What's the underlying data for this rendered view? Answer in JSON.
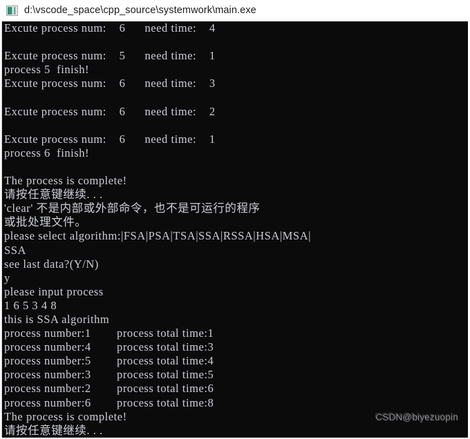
{
  "window": {
    "title": "d:\\vscode_space\\cpp_source\\systemwork\\main.exe",
    "icon": "console-window-icon",
    "titlebar_bg": "#ffffff",
    "console_bg": "#0b0b0b",
    "console_fg": "#c8c8d0"
  },
  "console": {
    "lines": [
      "Excute process num:    6      need time:    4",
      "",
      "Excute process num:    5      need time:    1",
      "process 5  finish!",
      "Excute process num:    6      need time:    3",
      "",
      "Excute process num:    6      need time:    2",
      "",
      "Excute process num:    6      need time:    1",
      "process 6  finish!",
      "",
      "The process is complete!",
      "请按任意键继续. . .",
      "'clear' 不是内部或外部命令，也不是可运行的程序",
      "或批处理文件。",
      "please select algorithm:|FSA|PSA|TSA|SSA|RSSA|HSA|MSA|",
      "SSA",
      "see last data?(Y/N)",
      "y",
      "please input process",
      "1 6 5 3 4 8",
      "this is SSA algorithm",
      "process number:1        process total time:1",
      "process number:4        process total time:3",
      "process number:5        process total time:4",
      "process number:3        process total time:5",
      "process number:2        process total time:6",
      "process number:6        process total time:8",
      "The process is complete!",
      "请按任意键继续. . ."
    ],
    "execution_log": [
      {
        "process_num": "6",
        "need_time": "4"
      },
      {
        "process_num": "5",
        "need_time": "1",
        "finish": "process 5  finish!"
      },
      {
        "process_num": "6",
        "need_time": "3"
      },
      {
        "process_num": "6",
        "need_time": "2"
      },
      {
        "process_num": "6",
        "need_time": "1",
        "finish": "process 6  finish!"
      }
    ],
    "prompts": {
      "complete": "The process is complete!",
      "press_any_key": "请按任意键继续. . .",
      "clear_error_line1": "'clear' 不是内部或外部命令，也不是可运行的程序",
      "clear_error_line2": "或批处理文件。",
      "select_algorithm": "please select algorithm:|FSA|PSA|TSA|SSA|RSSA|HSA|MSA|",
      "selected_algorithm": "SSA",
      "see_last_data": "see last data?(Y/N)",
      "see_last_data_answer": "y",
      "input_process": "please input process",
      "input_process_values": "1 6 5 3 4 8",
      "algorithm_banner": "this is SSA algorithm"
    },
    "algorithm_options": [
      "FSA",
      "PSA",
      "TSA",
      "SSA",
      "RSSA",
      "HSA",
      "MSA"
    ],
    "results_headers": [
      "process number",
      "process total time"
    ],
    "results": [
      {
        "number": "1",
        "total_time": "1"
      },
      {
        "number": "4",
        "total_time": "3"
      },
      {
        "number": "5",
        "total_time": "4"
      },
      {
        "number": "3",
        "total_time": "5"
      },
      {
        "number": "2",
        "total_time": "6"
      },
      {
        "number": "6",
        "total_time": "8"
      }
    ]
  },
  "watermark": {
    "text": "CSDN@biyezuopin",
    "ghost_text": "CSDN@biyezuopin"
  }
}
